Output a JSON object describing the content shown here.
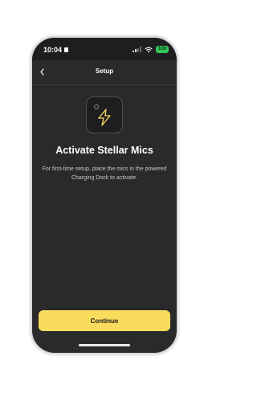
{
  "status_bar": {
    "time": "10:04",
    "battery": "100"
  },
  "nav": {
    "title": "Setup",
    "back_icon": "chevron-left-icon"
  },
  "device_icon": "lightning-bolt-icon",
  "main": {
    "heading": "Activate Stellar Mics",
    "description": "For first-time setup, place the mics in the powered Charging Dock to activate."
  },
  "footer": {
    "continue_label": "Continue"
  },
  "colors": {
    "accent": "#f9dc5c",
    "background": "#2a2a2c",
    "battery": "#34c759"
  }
}
